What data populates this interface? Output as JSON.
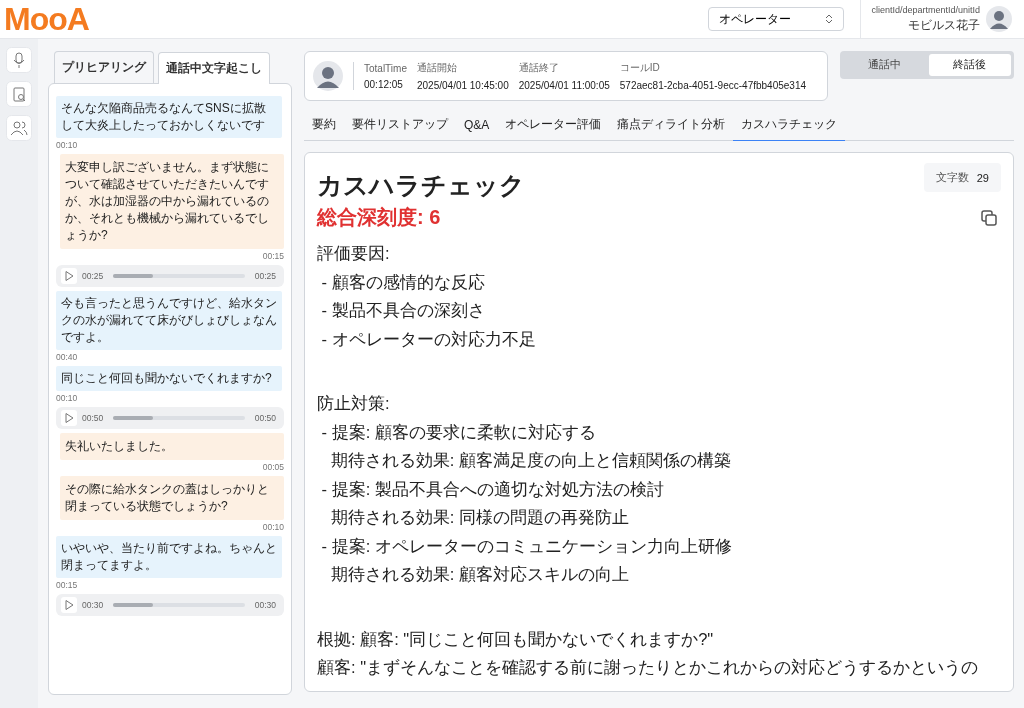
{
  "header": {
    "logo": "MooA",
    "role_select": "オペレーター",
    "user_path": "clientId/departmentId/unitId",
    "user_name": "モビルス花子"
  },
  "left_tabs": [
    {
      "label": "プリヒアリング",
      "selected": false
    },
    {
      "label": "通話中文字起こし",
      "selected": true
    }
  ],
  "transcript": [
    {
      "kind": "customer",
      "text": "そんな欠陥商品売るなんてSNSに拡散して大炎上したっておかしくないです",
      "time": "00:10"
    },
    {
      "kind": "operator",
      "text": "大変申し訳ございません。まず状態について確認させていただきたいんですが、水は加湿器の中から漏れているのか、それとも機械から漏れているでしょうか?",
      "time": "00:15"
    },
    {
      "kind": "audio",
      "start": "00:25",
      "end": "00:25",
      "level": 0.3
    },
    {
      "kind": "customer",
      "text": "今も言ったと思うんですけど、給水タンクの水が漏れてて床がびしょびしょなんですよ。",
      "time": "00:40"
    },
    {
      "kind": "customer",
      "text": "同じこと何回も聞かないでくれますか?",
      "time": "00:10"
    },
    {
      "kind": "audio",
      "start": "00:50",
      "end": "00:50",
      "level": 0.3
    },
    {
      "kind": "operator",
      "text": "失礼いたしました。",
      "time": "00:05"
    },
    {
      "kind": "operator",
      "text": "その際に給水タンクの蓋はしっかりと閉まっている状態でしょうか?",
      "time": "00:10"
    },
    {
      "kind": "customer",
      "text": "いやいや、当たり前ですよね。ちゃんと閉まってますよ。",
      "time": "00:15"
    },
    {
      "kind": "audio",
      "start": "00:30",
      "end": "00:30",
      "level": 0.3
    }
  ],
  "call_info": [
    {
      "label": "TotalTime",
      "value": "00:12:05"
    },
    {
      "label": "通話開始",
      "value": "2025/04/01 10:45:00"
    },
    {
      "label": "通話終了",
      "value": "2025/04/01 11:00:05"
    },
    {
      "label": "コールID",
      "value": "572aec81-2cba-4051-9ecc-47fbb405e314"
    }
  ],
  "call_state": [
    {
      "label": "通話中",
      "selected": false
    },
    {
      "label": "終話後",
      "selected": true
    }
  ],
  "main_tabs": [
    {
      "label": "要約",
      "selected": false
    },
    {
      "label": "要件リストアップ",
      "selected": false
    },
    {
      "label": "Q&A",
      "selected": false
    },
    {
      "label": "オペレーター評価",
      "selected": false
    },
    {
      "label": "痛点ディライト分析",
      "selected": false
    },
    {
      "label": "カスハラチェック",
      "selected": true
    }
  ],
  "report": {
    "title": "カスハラチェック",
    "char_count_label": "文字数",
    "char_count": "29",
    "severity": "総合深刻度: 6",
    "sections": [
      [
        "評価要因:",
        " - 顧客の感情的な反応",
        " - 製品不具合の深刻さ",
        " - オペレーターの対応力不足"
      ],
      [
        "防止対策:",
        " - 提案: 顧客の要求に柔軟に対応する",
        "   期待される効果: 顧客満足度の向上と信頼関係の構築",
        " - 提案: 製品不具合への適切な対処方法の検討",
        "   期待される効果: 同様の問題の再発防止",
        " - 提案: オペレーターのコミュニケーション力向上研修",
        "   期待される効果: 顧客対応スキルの向上"
      ],
      [
        "根拠: 顧客: \"同じこと何回も聞かないでくれますか?\"",
        "顧客: \"まずそんなことを確認する前に謝ったりとかこれからの対応どうするかというの"
      ]
    ]
  }
}
